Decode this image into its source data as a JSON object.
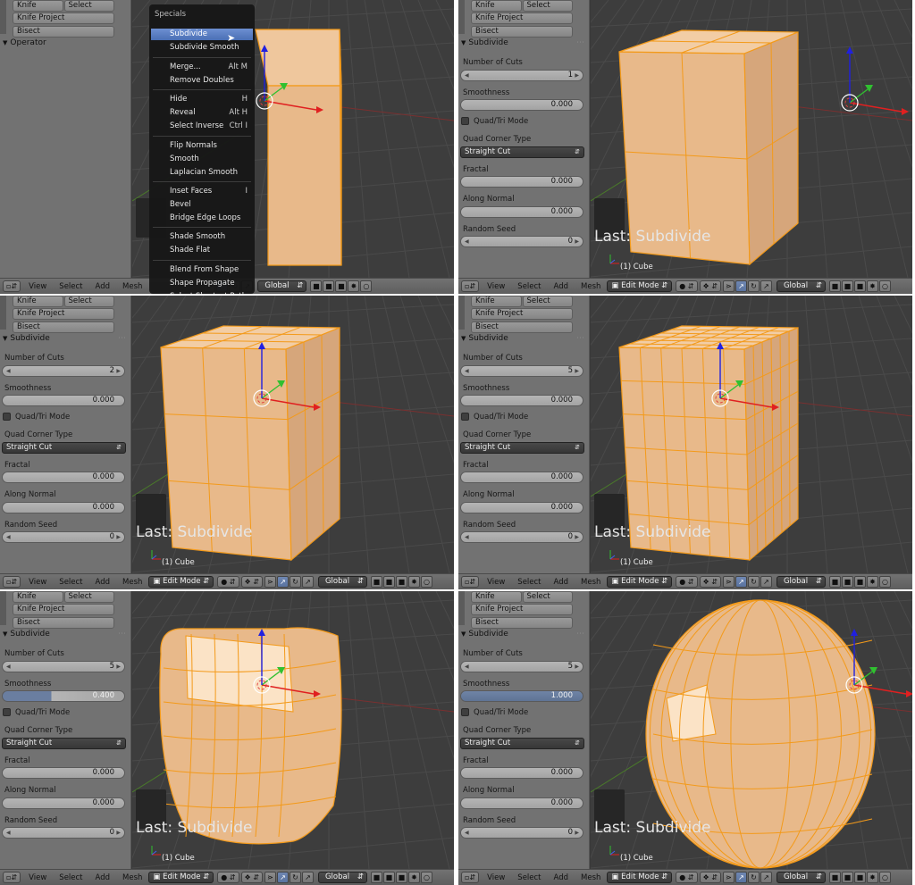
{
  "shelf": {
    "knife": "Knife",
    "select": "Select",
    "knife_project": "Knife Project",
    "bisect": "Bisect",
    "operator_header": "Operator",
    "subdivide_header": "Subdivide",
    "number_of_cuts_label": "Number of Cuts",
    "smoothness_label": "Smoothness",
    "quad_tri_label": "Quad/Tri Mode",
    "quad_corner_label": "Quad Corner Type",
    "quad_corner_value": "Straight Cut",
    "fractal_label": "Fractal",
    "fractal_value": "0.000",
    "along_normal_label": "Along Normal",
    "along_normal_value": "0.000",
    "random_seed_label": "Random Seed",
    "random_seed_value": "0"
  },
  "panels": [
    {
      "id": "p1",
      "cuts": null,
      "smoothness": null
    },
    {
      "id": "p2",
      "cuts": "1",
      "smoothness": "0.000"
    },
    {
      "id": "p3",
      "cuts": "2",
      "smoothness": "0.000"
    },
    {
      "id": "p4",
      "cuts": "5",
      "smoothness": "0.000"
    },
    {
      "id": "p5",
      "cuts": "5",
      "smoothness": "0.400"
    },
    {
      "id": "p6",
      "cuts": "5",
      "smoothness": "1.000"
    }
  ],
  "viewport": {
    "last_op": "Last: Subdivide",
    "object_name": "(1) Cube"
  },
  "header": {
    "view": "View",
    "select": "Select",
    "add": "Add",
    "mesh": "Mesh",
    "mode": "Edit Mode",
    "orientation": "Global"
  },
  "specials_menu": {
    "title": "Specials",
    "items": [
      {
        "label": "Subdivide",
        "shortcut": ""
      },
      {
        "label": "Subdivide Smooth",
        "shortcut": ""
      },
      {
        "label": "Merge...",
        "shortcut": "Alt M"
      },
      {
        "label": "Remove Doubles",
        "shortcut": ""
      },
      {
        "label": "Hide",
        "shortcut": "H"
      },
      {
        "label": "Reveal",
        "shortcut": "Alt H"
      },
      {
        "label": "Select Inverse",
        "shortcut": "Ctrl I"
      },
      {
        "label": "Flip Normals",
        "shortcut": ""
      },
      {
        "label": "Smooth",
        "shortcut": ""
      },
      {
        "label": "Laplacian Smooth",
        "shortcut": ""
      },
      {
        "label": "Inset Faces",
        "shortcut": "I"
      },
      {
        "label": "Bevel",
        "shortcut": ""
      },
      {
        "label": "Bridge Edge Loops",
        "shortcut": ""
      },
      {
        "label": "Shade Smooth",
        "shortcut": ""
      },
      {
        "label": "Shade Flat",
        "shortcut": ""
      },
      {
        "label": "Blend From Shape",
        "shortcut": ""
      },
      {
        "label": "Shape Propagate",
        "shortcut": ""
      },
      {
        "label": "Select Shortest Path",
        "shortcut": ""
      }
    ]
  },
  "colors": {
    "mesh_face": "#e8b98a",
    "mesh_edge": "#f39a1a",
    "axis_x": "#e02020",
    "axis_y": "#30c030",
    "axis_z": "#2020e0",
    "menu_highlight": "#5b80c4"
  }
}
